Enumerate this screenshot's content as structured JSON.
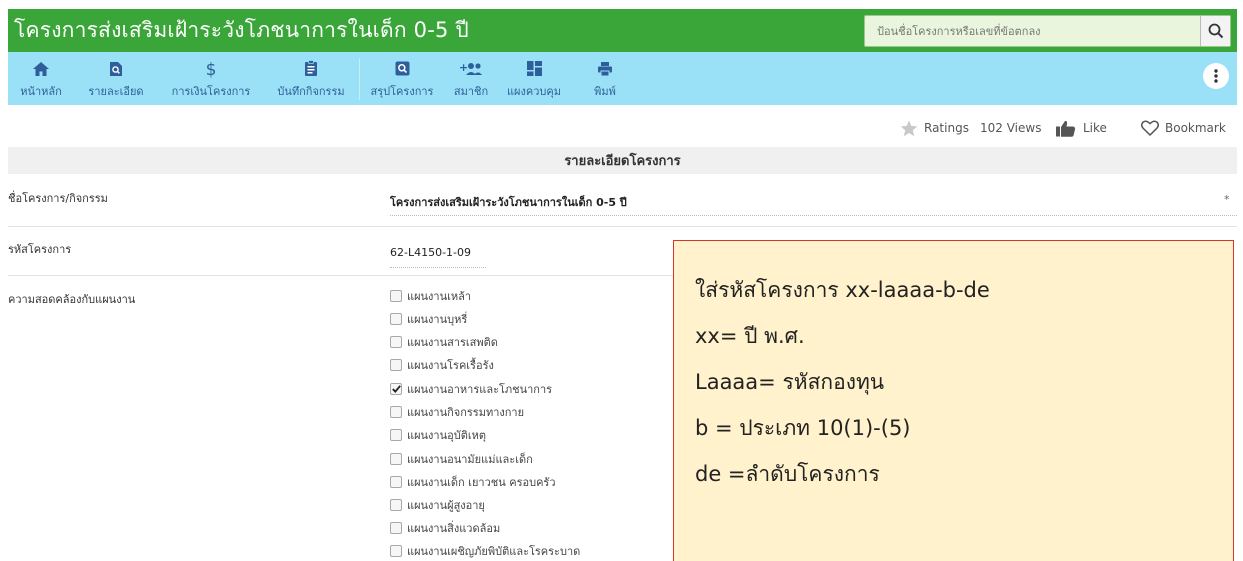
{
  "header": {
    "title": "โครงการส่งเสริมเฝ้าระวังโภชนาการในเด็ก 0-5 ปี",
    "search_placeholder": "ป้อนชื่อโครงการหรือเลขที่ข้อตกลง"
  },
  "toolbar": {
    "items": [
      {
        "label": "หน้าหลัก",
        "icon": "home-icon"
      },
      {
        "label": "รายละเอียด",
        "icon": "document-search-icon"
      },
      {
        "label": "การเงินโครงการ",
        "icon": "dollar-icon"
      },
      {
        "label": "บันทึกกิจกรรม",
        "icon": "clipboard-icon"
      },
      {
        "label": "สรุปโครงการ",
        "icon": "search-icon"
      },
      {
        "label": "สมาชิก",
        "icon": "add-people-icon"
      },
      {
        "label": "แผงควบคุม",
        "icon": "dashboard-icon"
      },
      {
        "label": "พิมพ์",
        "icon": "print-icon"
      }
    ],
    "more_icon": "more-vertical-icon"
  },
  "meta": {
    "ratings_label": "Ratings",
    "views": "102 Views",
    "like_label": "Like",
    "bookmark_label": "Bookmark"
  },
  "section": {
    "title": "รายละเอียดโครงการ"
  },
  "fields": {
    "project_name_label": "ชื่อโครงการ/กิจกรรม",
    "project_name_value": "โครงการส่งเสริมเฝ้าระวังโภชนาการในเด็ก 0-5 ปี",
    "required_mark": "*",
    "project_code_label": "รหัสโครงการ",
    "project_code_value": "62-L4150-1-09",
    "plan_alignment_label": "ความสอดคล้องกับแผนงาน"
  },
  "plans": [
    {
      "label": "แผนงานเหล้า",
      "checked": false
    },
    {
      "label": "แผนงานบุหรี่",
      "checked": false
    },
    {
      "label": "แผนงานสารเสพติด",
      "checked": false
    },
    {
      "label": "แผนงานโรคเรื้อรัง",
      "checked": false
    },
    {
      "label": "แผนงานอาหารและโภชนาการ",
      "checked": true
    },
    {
      "label": "แผนงานกิจกรรมทางกาย",
      "checked": false
    },
    {
      "label": "แผนงานอุบัติเหตุ",
      "checked": false
    },
    {
      "label": "แผนงานอนามัยแม่และเด็ก",
      "checked": false
    },
    {
      "label": "แผนงานเด็ก เยาวชน ครอบครัว",
      "checked": false
    },
    {
      "label": "แผนงานผู้สูงอายุ",
      "checked": false
    },
    {
      "label": "แผนงานสิ่งแวดล้อม",
      "checked": false
    },
    {
      "label": "แผนงานเผชิญภัยพิบัติและโรคระบาด",
      "checked": false
    }
  ],
  "note": {
    "lines": [
      "ใส่รหัสโครงการ xx-laaaa-b-de",
      "xx= ปี พ.ศ.",
      "Laaaa= รหัสกองทุน",
      "b = ประเภท 10(1)-(5)",
      "de =ลำดับโครงการ"
    ]
  },
  "colors": {
    "header_bg": "#3aa63a",
    "toolbar_bg": "#9ae0f6",
    "note_bg": "#fff2cc",
    "note_border": "#d9362b"
  }
}
